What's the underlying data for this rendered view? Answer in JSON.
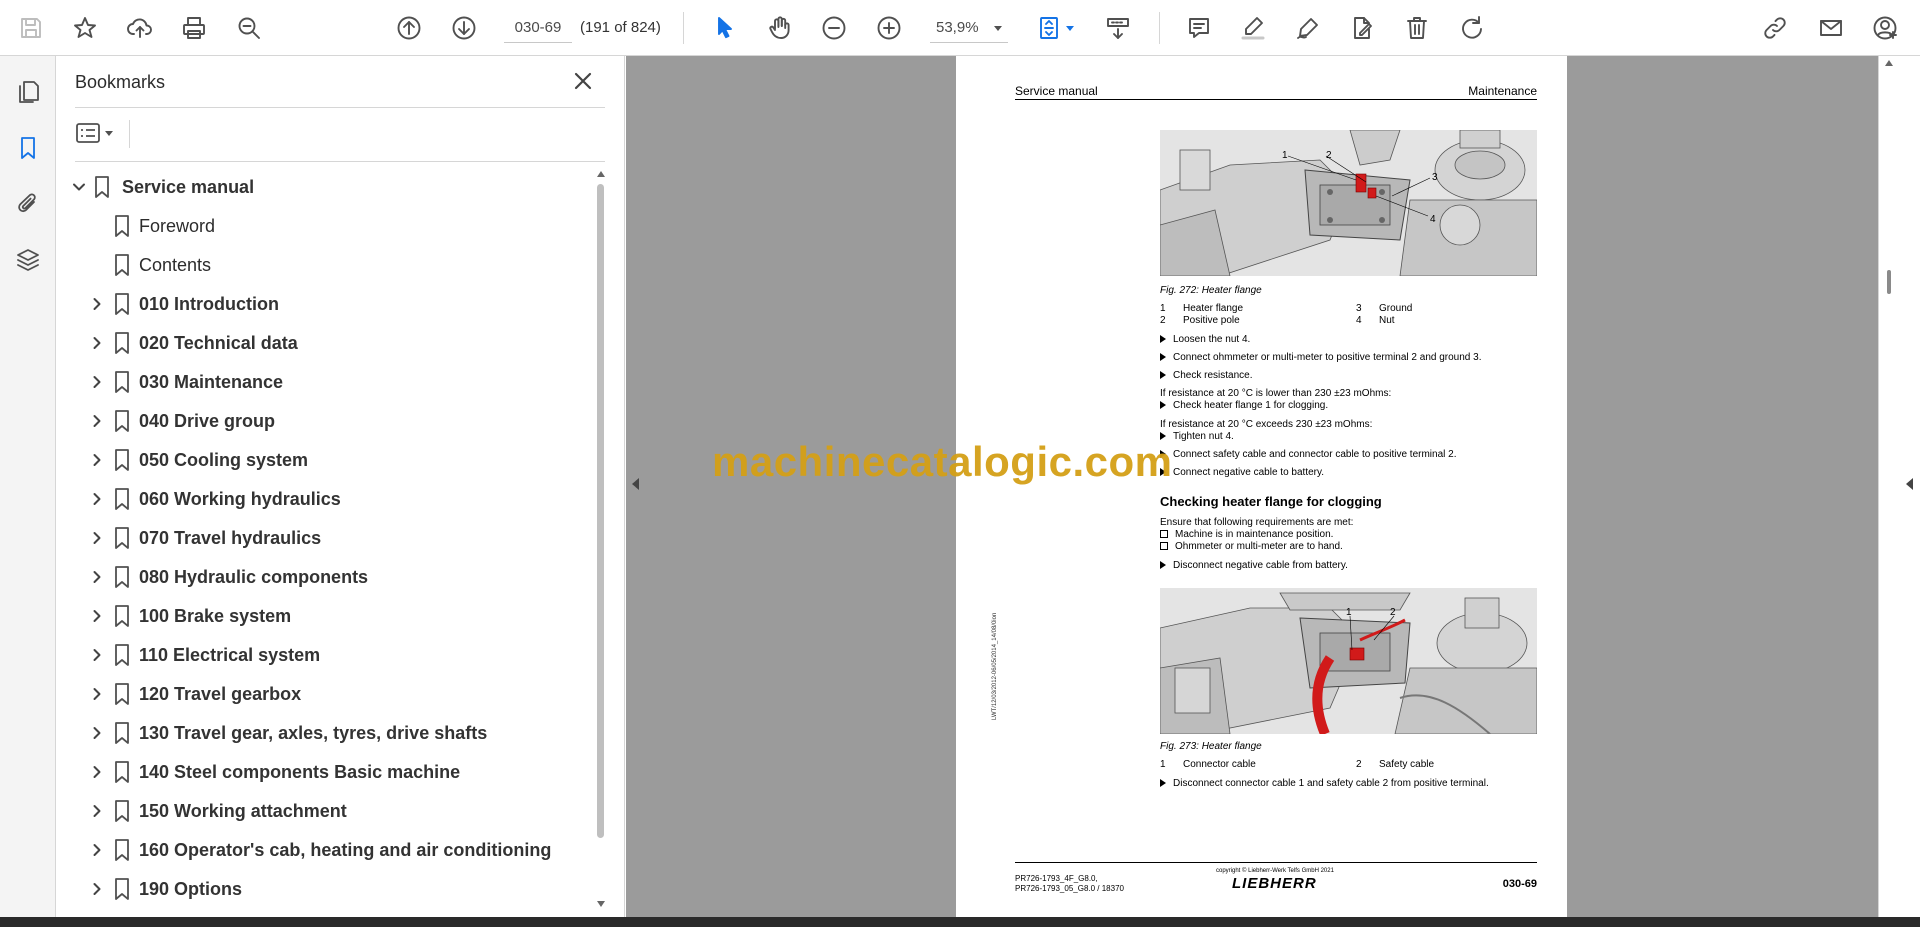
{
  "toolbar": {
    "page_number": "030-69",
    "page_count": "(191 of 824)",
    "zoom": "53,9%"
  },
  "bookmarks": {
    "title": "Bookmarks",
    "items": [
      {
        "label": "Service manual",
        "bold": true,
        "expanded": true,
        "level": 0
      },
      {
        "label": "Foreword",
        "bold": false,
        "level": 1
      },
      {
        "label": "Contents",
        "bold": false,
        "level": 1
      },
      {
        "label": "010 Introduction",
        "bold": true,
        "level": 1
      },
      {
        "label": "020 Technical data",
        "bold": true,
        "level": 1
      },
      {
        "label": "030 Maintenance",
        "bold": true,
        "level": 1
      },
      {
        "label": "040 Drive group",
        "bold": true,
        "level": 1
      },
      {
        "label": "050 Cooling system",
        "bold": true,
        "level": 1
      },
      {
        "label": "060 Working hydraulics",
        "bold": true,
        "level": 1
      },
      {
        "label": "070 Travel hydraulics",
        "bold": true,
        "level": 1
      },
      {
        "label": "080 Hydraulic components",
        "bold": true,
        "level": 1
      },
      {
        "label": "100 Brake system",
        "bold": true,
        "level": 1
      },
      {
        "label": "110 Electrical system",
        "bold": true,
        "level": 1
      },
      {
        "label": "120 Travel gearbox",
        "bold": true,
        "level": 1
      },
      {
        "label": "130 Travel gear, axles, tyres, drive shafts",
        "bold": true,
        "level": 1
      },
      {
        "label": "140 Steel components Basic machine",
        "bold": true,
        "level": 1
      },
      {
        "label": "150 Working attachment",
        "bold": true,
        "level": 1
      },
      {
        "label": "160 Operator's cab, heating and air conditioning",
        "bold": true,
        "level": 1
      },
      {
        "label": "190 Options",
        "bold": true,
        "level": 1
      }
    ]
  },
  "document": {
    "header_left": "Service manual",
    "header_right": "Maintenance",
    "fig1": {
      "caption": "Fig. 272: Heater flange",
      "callouts": [
        "1",
        "2",
        "3",
        "4"
      ],
      "legend": [
        {
          "num": "1",
          "text": "Heater flange"
        },
        {
          "num": "3",
          "text": "Ground"
        },
        {
          "num": "2",
          "text": "Positive pole"
        },
        {
          "num": "4",
          "text": "Nut"
        }
      ]
    },
    "steps1": [
      "Loosen the nut 4.",
      "Connect ohmmeter or multi-meter to positive terminal 2 and ground 3.",
      "Check resistance."
    ],
    "cond1": "If resistance at 20 °C is lower than 230 ±23 mOhms:",
    "cond1_step": "Check heater flange 1 for clogging.",
    "cond2": "If resistance at 20 °C exceeds 230 ±23 mOhms:",
    "cond2_steps": [
      "Tighten nut 4.",
      "Connect safety cable and connector cable to positive terminal 2.",
      "Connect negative cable to battery."
    ],
    "section_title": "Checking heater flange for clogging",
    "requirements_intro": "Ensure that following requirements are met:",
    "requirements": [
      "Machine is in maintenance position.",
      "Ohmmeter or multi-meter are to hand."
    ],
    "step_disconnect": "Disconnect negative cable from battery.",
    "fig2": {
      "caption": "Fig. 273: Heater flange",
      "callouts": [
        "1",
        "2"
      ],
      "legend": [
        {
          "num": "1",
          "text": "Connector cable"
        },
        {
          "num": "2",
          "text": "Safety cable"
        }
      ]
    },
    "final_step": "Disconnect connector cable 1 and safety cable 2 from positive terminal.",
    "side_code": "LWT/12/03/2012-06/05/2014_14/08/0ion",
    "footer_model_1": "PR726-1793_4F_G8.0,",
    "footer_model_2": "PR726-1793_05_G8.0 / 18370",
    "footer_copyright": "copyright © Liebherr-Werk Telfs GmbH 2021",
    "footer_logo": "LIEBHERR",
    "footer_page": "030-69"
  },
  "watermark": "machinecatalogic.com",
  "colors": {
    "accent": "#1473e6",
    "viewer_bg": "#9b9b9b",
    "watermark": "#d4a017",
    "cable_red": "#d11a1a"
  }
}
